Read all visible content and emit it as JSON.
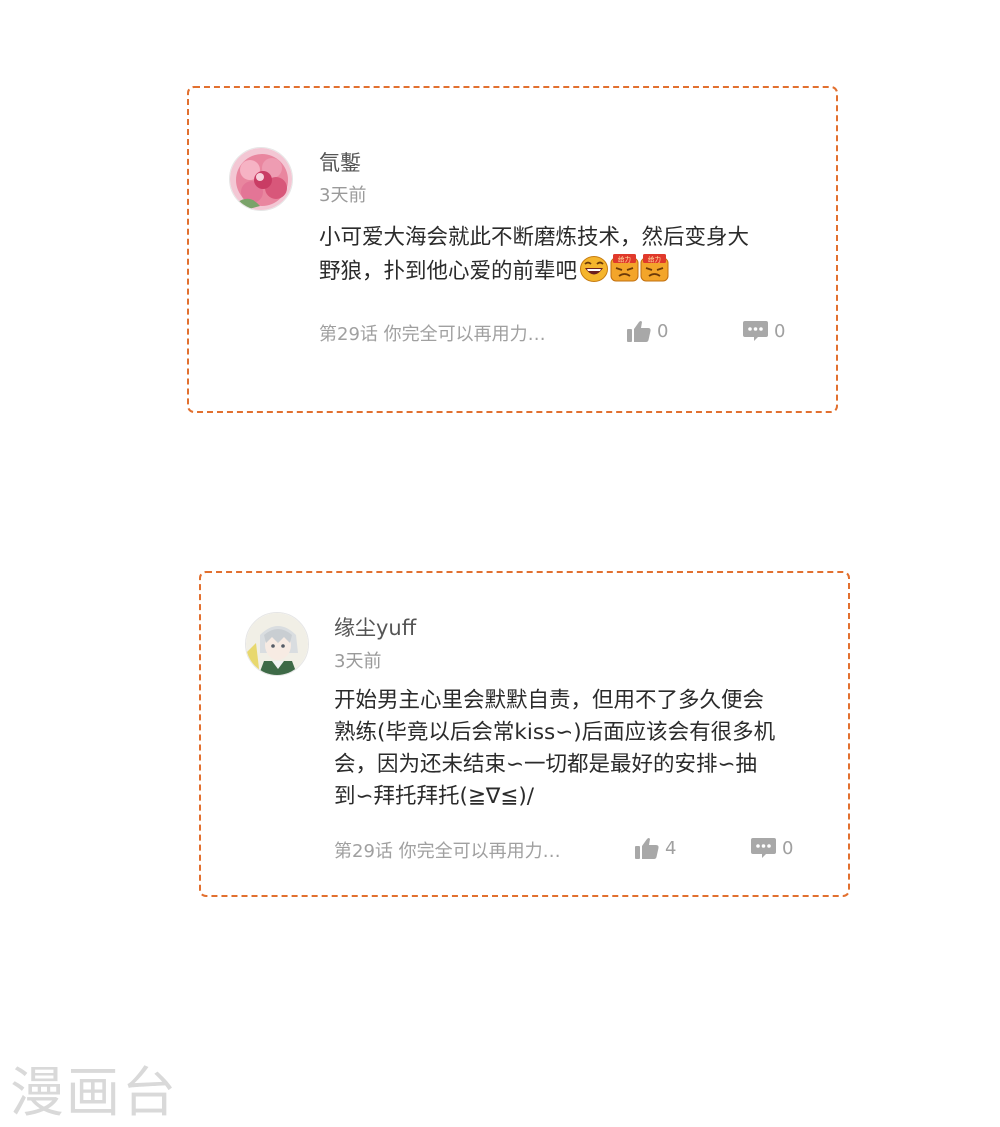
{
  "comments": [
    {
      "username": "氜鏨",
      "time": "3天前",
      "content_lines": [
        "小可爱大海会就此不断磨炼技术，然后变身大",
        "野狼，扑到他心爱的前辈吧"
      ],
      "emojis": [
        "laughing-emoji",
        "geili-emoji",
        "geili-emoji"
      ],
      "emoji_label": "给力",
      "chapter": "第29话 你完全可以再用力…",
      "likes": "0",
      "replies": "0",
      "avatar": "pink-flower-avatar"
    },
    {
      "username": "缘尘yuff",
      "time": "3天前",
      "content_lines": [
        "开始男主心里会默默自责，但用不了多久便会",
        "熟练(毕竟以后会常kiss∽)后面应该会有很多机",
        "会，因为还未结束∽一切都是最好的安排∽抽",
        "到∽拜托拜托(≧∇≦)/"
      ],
      "chapter": "第29话 你完全可以再用力…",
      "likes": "4",
      "replies": "0",
      "avatar": "anime-character-avatar"
    }
  ],
  "watermark": "漫画台",
  "colors": {
    "card_border": "#e2702f",
    "muted_text": "#9a9a9a",
    "body_text": "#2b2b2b",
    "icon": "#a8a8a8"
  }
}
